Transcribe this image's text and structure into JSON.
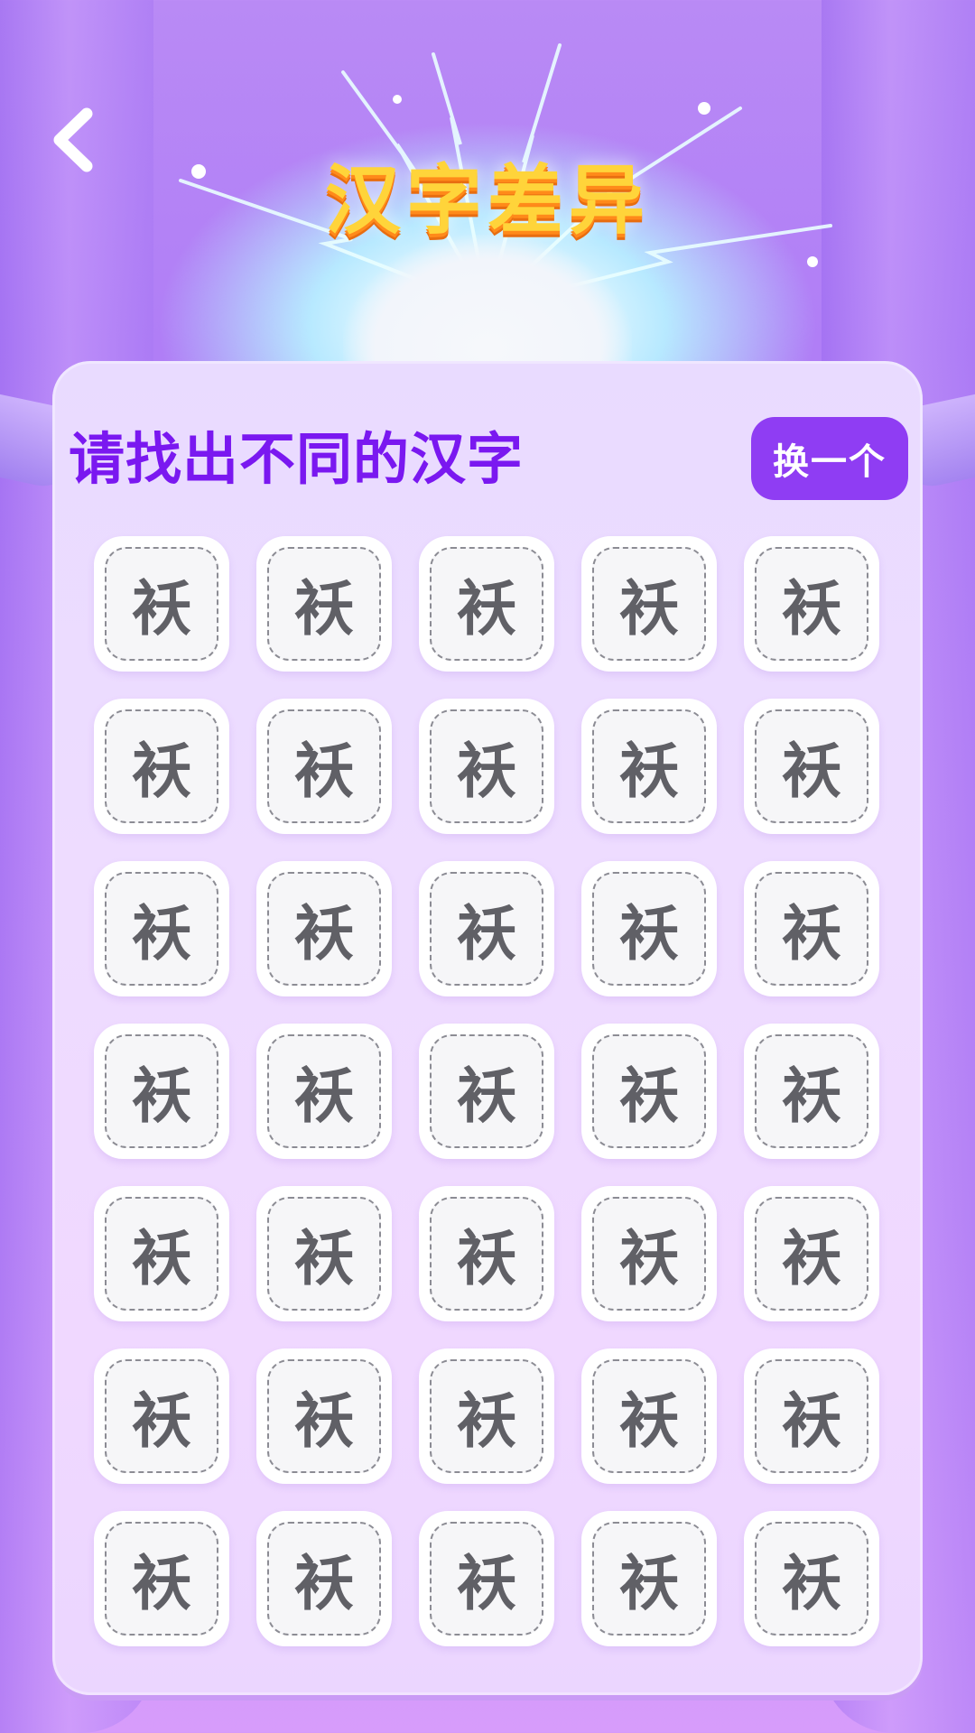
{
  "header": {
    "title": "汉字差异",
    "back_icon": "chevron-left-icon"
  },
  "panel": {
    "prompt": "请找出不同的汉字",
    "swap_label": "换一个"
  },
  "grid": {
    "rows": 7,
    "columns": 5,
    "cells": [
      "袄",
      "袄",
      "袄",
      "袄",
      "袄",
      "袄",
      "袄",
      "袄",
      "袄",
      "袄",
      "袄",
      "袄",
      "袄",
      "袄",
      "袄",
      "袄",
      "袄",
      "袄",
      "袄",
      "袄",
      "袄",
      "袄",
      "袄",
      "袄",
      "袄",
      "袄",
      "袄",
      "袄",
      "袄",
      "袄",
      "袄",
      "袄",
      "袄",
      "袄",
      "袄"
    ]
  },
  "colors": {
    "title": "#ffd43a",
    "prompt": "#7a18f0",
    "button": "#8f3df3",
    "glyph": "#606066"
  }
}
